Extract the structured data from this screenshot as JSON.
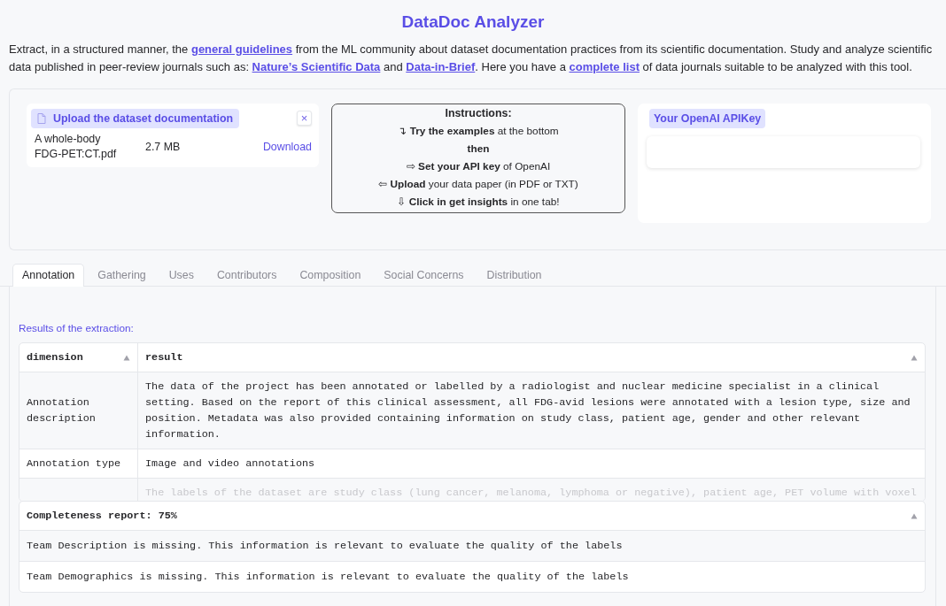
{
  "title": "DataDoc Analyzer",
  "intro": [
    {
      "kind": "text",
      "text": "Extract, in a structured manner, the "
    },
    {
      "kind": "link",
      "text": "general guidelines"
    },
    {
      "kind": "text",
      "text": " from the ML community about dataset documentation practices from its scientific documentation. Study and analyze scientific data published in peer-review journals such as: "
    },
    {
      "kind": "link",
      "text": "Nature’s Scientific Data"
    },
    {
      "kind": "text",
      "text": " and "
    },
    {
      "kind": "link",
      "text": "Data-in-Brief"
    },
    {
      "kind": "text",
      "text": ". Here you have a "
    },
    {
      "kind": "link",
      "text": "complete list"
    },
    {
      "kind": "text",
      "text": " of data journals suitable to be analyzed with this tool."
    }
  ],
  "upload": {
    "label": "Upload the dataset documentation",
    "close": "×",
    "file_name": "A whole-body FDG-PET:CT.pdf",
    "file_size": "2.7 MB",
    "download": "Download"
  },
  "instructions": {
    "title": "Instructions:",
    "lines": [
      "↴ **Try the examples** at the bottom",
      "**then**",
      "⇨ **Set your API key** of OpenAI",
      "⇦ **Upload** your data paper (in PDF or TXT)",
      "⇩ **Click in get insights** in one tab!"
    ]
  },
  "api_key": {
    "label": "Your OpenAI APIKey"
  },
  "tabs": [
    {
      "label": "Annotation",
      "selected": true
    },
    {
      "label": "Gathering",
      "selected": false
    },
    {
      "label": "Uses",
      "selected": false
    },
    {
      "label": "Contributors",
      "selected": false
    },
    {
      "label": "Composition",
      "selected": false
    },
    {
      "label": "Social Concerns",
      "selected": false
    },
    {
      "label": "Distribution",
      "selected": false
    }
  ],
  "results_label": "Results of the extraction:",
  "results_table": {
    "columns": [
      "dimension",
      "result"
    ],
    "rows": [
      [
        "Annotation description",
        "The data of the project has been annotated or labelled by a radiologist and nuclear medicine specialist in a clinical setting. Based on the report of this clinical assessment, all FDG-avid lesions were annotated with a lesion type, size and position. Metadata was also provided containing information on study class, patient age, gender and other relevant information."
      ],
      [
        "Annotation type",
        "Image and video annotations"
      ],
      [
        "",
        "The labels of the dataset are study class (lung cancer, melanoma, lymphoma or negative), patient age, PET volume with voxel"
      ]
    ]
  },
  "completeness_table": {
    "header": "Completeness report: 75%",
    "rows": [
      "Team Description is missing. This information is relevant to evaluate the quality of the labels",
      "Team Demographics is missing. This information is relevant to evaluate the quality of the labels"
    ]
  }
}
